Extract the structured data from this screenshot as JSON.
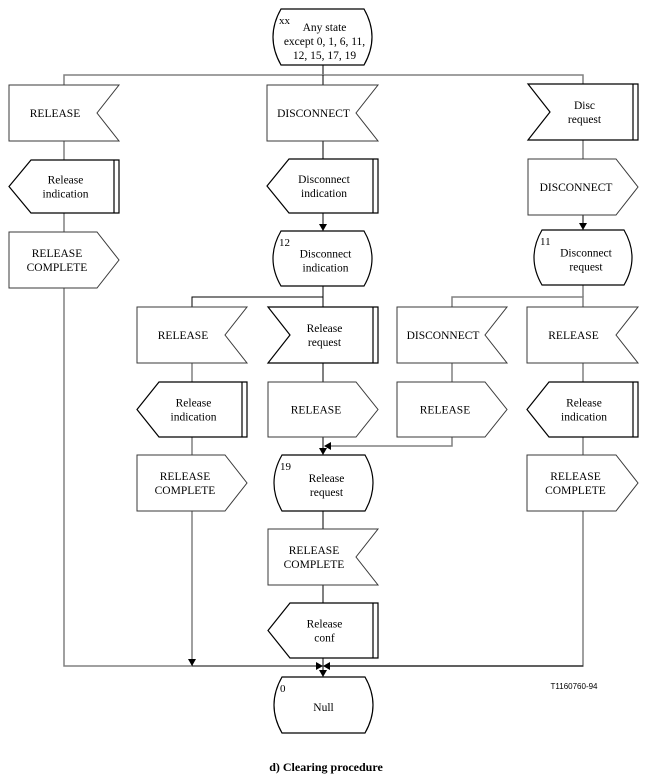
{
  "figure": {
    "caption": "d)  Clearing procedure",
    "figure_id": "T1160760-94"
  },
  "nodes": {
    "start_state": {
      "type": "state",
      "number": "xx",
      "lines": [
        "Any state",
        "except 0, 1, 6, 11,",
        "12, 15, 17, 19"
      ]
    },
    "c1_release_in": {
      "type": "input",
      "lines": [
        "RELEASE"
      ]
    },
    "c1_release_ind": {
      "type": "output-internal",
      "lines": [
        "Release",
        "indication"
      ]
    },
    "c1_release_complete_out": {
      "type": "output",
      "lines": [
        "RELEASE",
        "COMPLETE"
      ]
    },
    "c2_disconnect_in": {
      "type": "input",
      "lines": [
        "DISCONNECT"
      ]
    },
    "c2_disconnect_ind": {
      "type": "output-internal",
      "lines": [
        "Disconnect",
        "indication"
      ]
    },
    "state_12": {
      "type": "state",
      "number": "12",
      "lines": [
        "Disconnect",
        "indication"
      ]
    },
    "c3_disc_req": {
      "type": "input-internal",
      "lines": [
        "Disc",
        "request"
      ]
    },
    "c3_disconnect_out": {
      "type": "output",
      "lines": [
        "DISCONNECT"
      ]
    },
    "state_11": {
      "type": "state",
      "number": "11",
      "lines": [
        "Disconnect",
        "request"
      ]
    },
    "s12a_release_in": {
      "type": "input",
      "lines": [
        "RELEASE"
      ]
    },
    "s12a_release_ind": {
      "type": "output-internal",
      "lines": [
        "Release",
        "indication"
      ]
    },
    "s12a_release_complete_out": {
      "type": "output",
      "lines": [
        "RELEASE",
        "COMPLETE"
      ]
    },
    "s12b_release_req": {
      "type": "input-internal",
      "lines": [
        "Release",
        "request"
      ]
    },
    "s12b_release_out": {
      "type": "output",
      "lines": [
        "RELEASE"
      ]
    },
    "s11a_disconnect_in": {
      "type": "input",
      "lines": [
        "DISCONNECT"
      ]
    },
    "s11a_release_out": {
      "type": "output",
      "lines": [
        "RELEASE"
      ]
    },
    "s11b_release_in": {
      "type": "input",
      "lines": [
        "RELEASE"
      ]
    },
    "s11b_release_ind": {
      "type": "output-internal",
      "lines": [
        "Release",
        "indication"
      ]
    },
    "s11b_release_complete_out": {
      "type": "output",
      "lines": [
        "RELEASE",
        "COMPLETE"
      ]
    },
    "state_19": {
      "type": "state",
      "number": "19",
      "lines": [
        "Release",
        "request"
      ]
    },
    "s19_release_complete_in": {
      "type": "input",
      "lines": [
        "RELEASE",
        "COMPLETE"
      ]
    },
    "s19_release_conf": {
      "type": "output-internal",
      "lines": [
        "Release",
        "conf"
      ]
    },
    "state_0": {
      "type": "state",
      "number": "0",
      "lines": [
        "Null"
      ]
    }
  },
  "edges": [
    [
      "start_state",
      "c1_release_in"
    ],
    [
      "start_state",
      "c2_disconnect_in"
    ],
    [
      "start_state",
      "c3_disc_req"
    ],
    [
      "c1_release_in",
      "c1_release_ind"
    ],
    [
      "c1_release_ind",
      "c1_release_complete_out"
    ],
    [
      "c1_release_complete_out",
      "state_0"
    ],
    [
      "c2_disconnect_in",
      "c2_disconnect_ind"
    ],
    [
      "c2_disconnect_ind",
      "state_12"
    ],
    [
      "c3_disc_req",
      "c3_disconnect_out"
    ],
    [
      "c3_disconnect_out",
      "state_11"
    ],
    [
      "state_12",
      "s12a_release_in"
    ],
    [
      "state_12",
      "s12b_release_req"
    ],
    [
      "s12a_release_in",
      "s12a_release_ind"
    ],
    [
      "s12a_release_ind",
      "s12a_release_complete_out"
    ],
    [
      "s12a_release_complete_out",
      "state_0"
    ],
    [
      "s12b_release_req",
      "s12b_release_out"
    ],
    [
      "s12b_release_out",
      "state_19"
    ],
    [
      "state_11",
      "s11a_disconnect_in"
    ],
    [
      "state_11",
      "s11b_release_in"
    ],
    [
      "s11a_disconnect_in",
      "s11a_release_out"
    ],
    [
      "s11a_release_out",
      "state_19"
    ],
    [
      "s11b_release_in",
      "s11b_release_ind"
    ],
    [
      "s11b_release_ind",
      "s11b_release_complete_out"
    ],
    [
      "s11b_release_complete_out",
      "state_0"
    ],
    [
      "state_19",
      "s19_release_complete_in"
    ],
    [
      "s19_release_complete_in",
      "s19_release_conf"
    ],
    [
      "s19_release_conf",
      "state_0"
    ]
  ]
}
